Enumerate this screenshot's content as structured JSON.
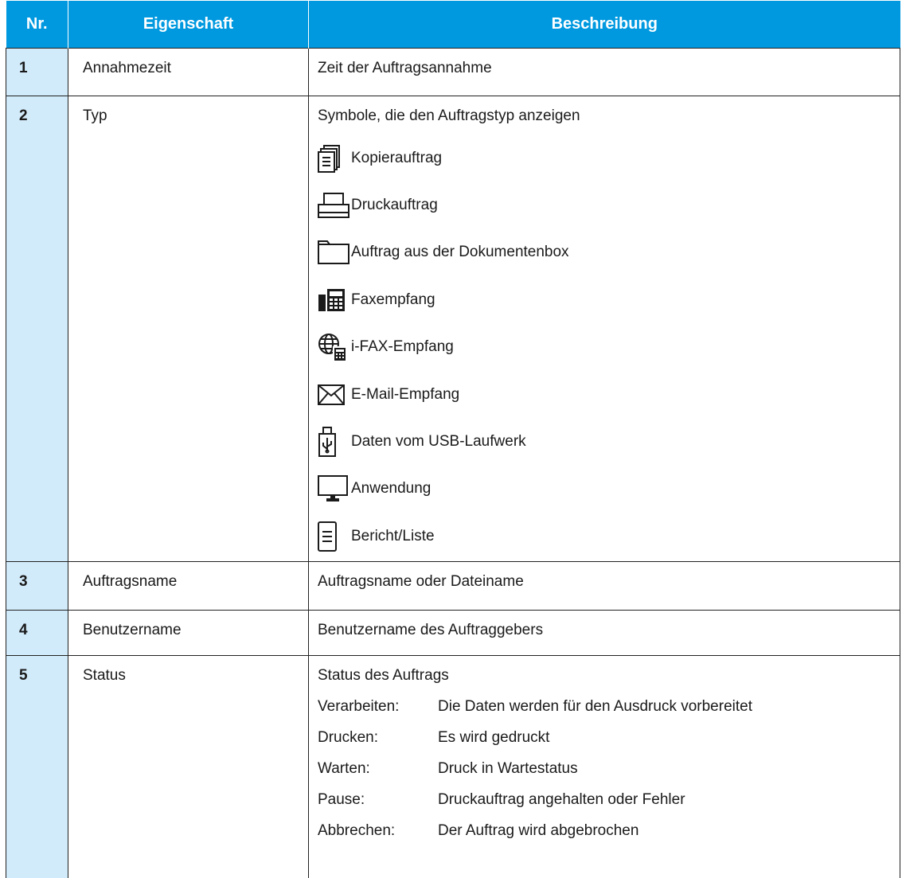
{
  "table": {
    "headers": [
      "Nr.",
      "Eigenschaft",
      "Beschreibung"
    ],
    "rows": [
      {
        "nr": "1",
        "property": "Annahmezeit",
        "description": "Zeit der Auftragsannahme"
      },
      {
        "nr": "2",
        "property": "Typ",
        "description": "Symbole, die den Auftragstyp anzeigen",
        "icons": [
          {
            "icon": "copy-job-icon",
            "label": "Kopierauftrag"
          },
          {
            "icon": "printer-icon",
            "label": "Druckauftrag"
          },
          {
            "icon": "folder-icon",
            "label": "Auftrag aus der Dokumentenbox"
          },
          {
            "icon": "fax-icon",
            "label": "Faxempfang"
          },
          {
            "icon": "ifax-icon",
            "label": "i-FAX-Empfang"
          },
          {
            "icon": "email-icon",
            "label": "E-Mail-Empfang"
          },
          {
            "icon": "usb-drive-icon",
            "label": "Daten vom USB-Laufwerk"
          },
          {
            "icon": "monitor-icon",
            "label": "Anwendung"
          },
          {
            "icon": "report-list-icon",
            "label": "Bericht/Liste"
          }
        ]
      },
      {
        "nr": "3",
        "property": "Auftragsname",
        "description": "Auftragsname oder Dateiname"
      },
      {
        "nr": "4",
        "property": "Benutzername",
        "description": "Benutzername des Auftraggebers"
      },
      {
        "nr": "5",
        "property": "Status",
        "description": "Status des Auftrags",
        "statuses": [
          {
            "key": "Verarbeiten:",
            "value": "Die Daten werden für den Ausdruck vorbereitet"
          },
          {
            "key": "Drucken:",
            "value": "Es wird gedruckt"
          },
          {
            "key": "Warten:",
            "value": "Druck in Wartestatus"
          },
          {
            "key": "Pause:",
            "value": "Druckauftrag angehalten oder Fehler"
          },
          {
            "key": "Abbrechen:",
            "value": "Der Auftrag wird abgebrochen"
          }
        ]
      }
    ]
  },
  "colors": {
    "header_bg": "#0099e0",
    "number_cell_bg": "#d2ebfa"
  }
}
